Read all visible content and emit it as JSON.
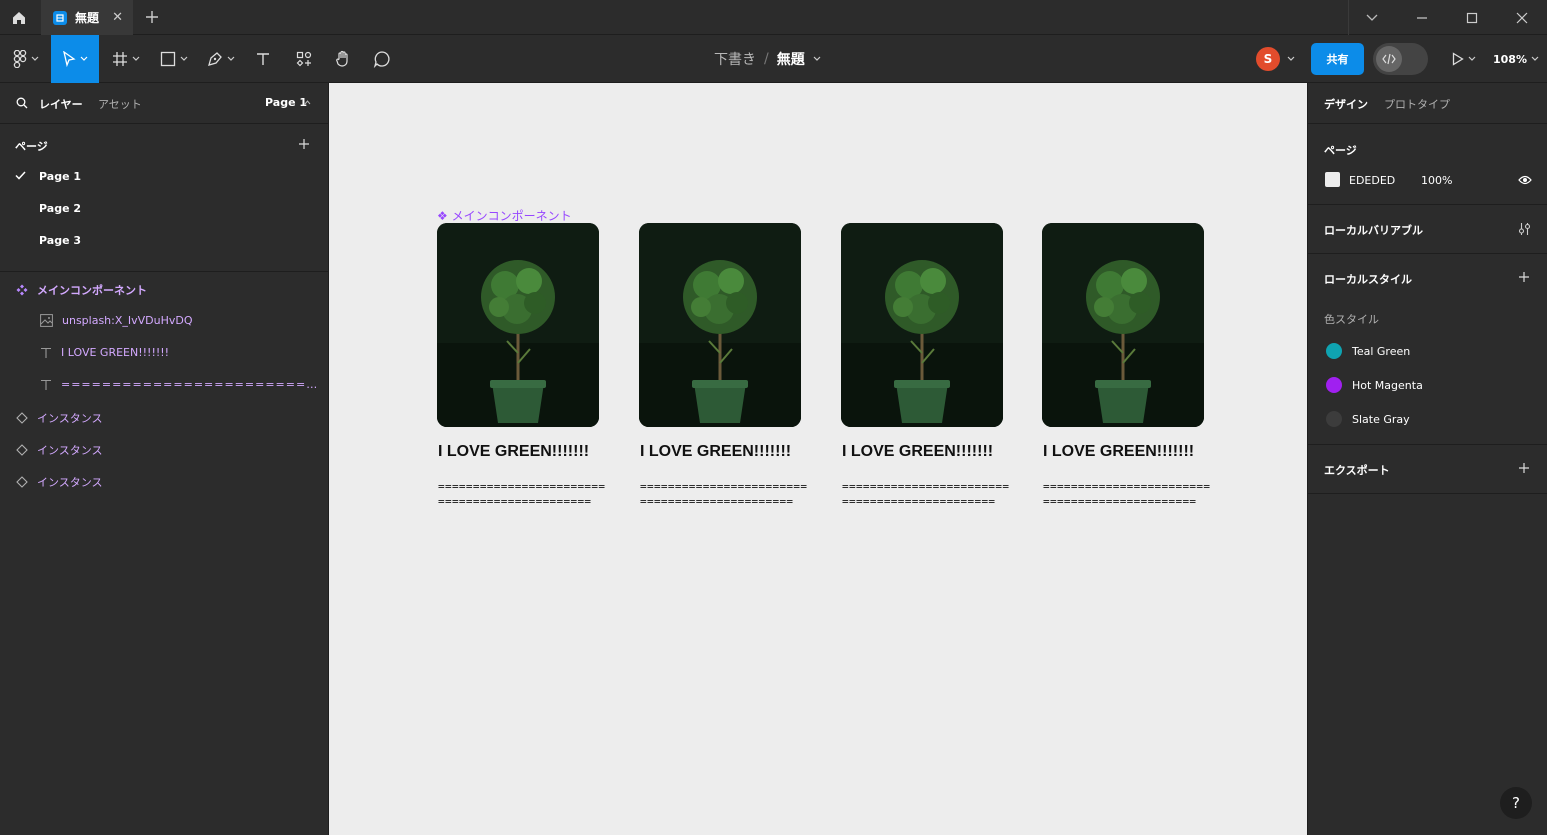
{
  "titlebar": {
    "tab_title": "無題",
    "tab_close": "✕"
  },
  "toolbar": {
    "draft_label": "下書き",
    "path_separator": "/",
    "file_name": "無題",
    "avatar_initial": "S",
    "share_label": "共有",
    "zoom_label": "108%"
  },
  "left_panel": {
    "tab_layers": "レイヤー",
    "tab_assets": "アセット",
    "page_selector": "Page 1",
    "pages_title": "ページ",
    "pages": [
      "Page 1",
      "Page 2",
      "Page 3"
    ],
    "layers": {
      "component": "メインコンポーネント",
      "image": "unsplash:X_IvVDuHvDQ",
      "text1": "I LOVE GREEN!!!!!!!",
      "text2": "========================================",
      "instance1": "インスタンス",
      "instance2": "インスタンス",
      "instance3": "インスタンス"
    }
  },
  "canvas": {
    "component_label": "❖ メインコンポーネント",
    "background": "#EDEDED",
    "cards": [
      {
        "title": "I LOVE GREEN!!!!!!!",
        "body": "=============================================="
      },
      {
        "title": "I LOVE GREEN!!!!!!!",
        "body": "=============================================="
      },
      {
        "title": "I LOVE GREEN!!!!!!!",
        "body": "=============================================="
      },
      {
        "title": "I LOVE GREEN!!!!!!!",
        "body": "=============================================="
      }
    ]
  },
  "right_panel": {
    "tab_design": "デザイン",
    "tab_prototype": "プロトタイプ",
    "page_section": "ページ",
    "page_color": "EDEDED",
    "page_opacity": "100%",
    "local_variables": "ローカルバリアブル",
    "local_styles": "ローカルスタイル",
    "color_styles_label": "色スタイル",
    "color_styles": [
      {
        "name": "Teal Green",
        "color": "#0fa3b1"
      },
      {
        "name": "Hot Magenta",
        "color": "#a020f0"
      },
      {
        "name": "Slate Gray",
        "color": "#3c3c3c"
      }
    ],
    "export": "エクスポート"
  },
  "help_label": "?"
}
